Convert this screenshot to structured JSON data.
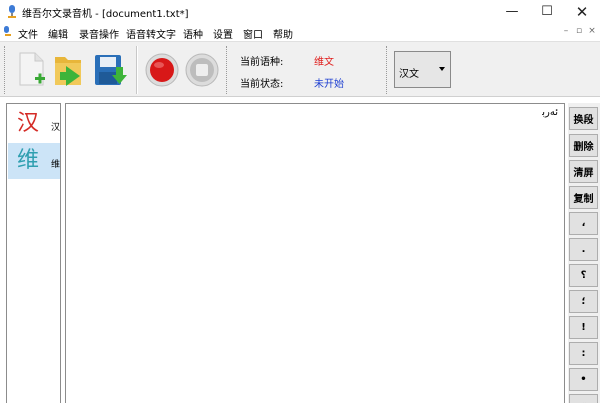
{
  "window": {
    "title": "维吾尔文录音机 - [document1.txt*]",
    "controls": {
      "minimize": "—",
      "maximize": "☐",
      "close": "✕"
    }
  },
  "menu": {
    "items": [
      "文件",
      "编辑",
      "录音操作",
      "语音转文字",
      "语种",
      "设置",
      "窗口",
      "帮助"
    ],
    "mdi_controls": [
      "–",
      "▫",
      "×"
    ]
  },
  "toolbar": {
    "buttons": [
      "new-document",
      "open-folder",
      "save",
      "record",
      "stop"
    ],
    "current_language_label": "当前语种:",
    "current_language_value": "维文",
    "current_status_label": "当前状态:",
    "current_status_value": "未开始",
    "language_select_value": "汉文",
    "colors": {
      "language_value": "#e0201e",
      "status_value": "#1e3fd1",
      "record_red": "#d81818"
    }
  },
  "languages": [
    {
      "glyph": "汉",
      "label": "汉",
      "color": "#d42b26"
    },
    {
      "glyph": "维",
      "label": "维",
      "color": "#2f9fb0"
    }
  ],
  "editor": {
    "corner_text": "ﺋﻪﺭﺑ"
  },
  "side_buttons": [
    "换段",
    "删除",
    "清屏",
    "复制",
    "،",
    ".",
    "؟",
    "؛",
    "!",
    ":",
    "•",
    "«"
  ]
}
